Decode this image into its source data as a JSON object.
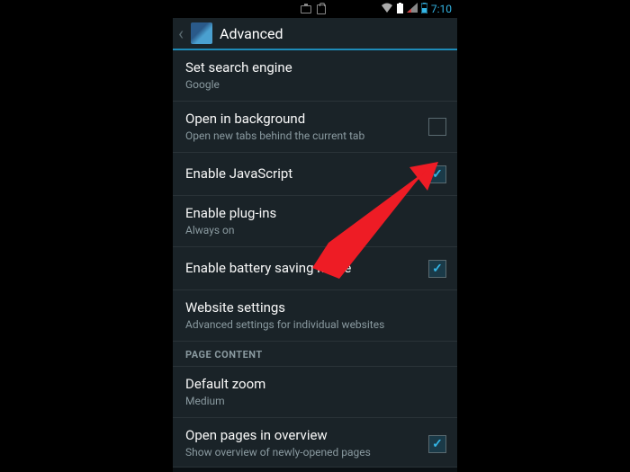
{
  "statusbar": {
    "time": "7:10"
  },
  "titlebar": {
    "title": "Advanced"
  },
  "items": {
    "search": {
      "title": "Set search engine",
      "sub": "Google"
    },
    "openbg": {
      "title": "Open in background",
      "sub": "Open new tabs behind the current tab"
    },
    "js": {
      "title": "Enable JavaScript"
    },
    "plugins": {
      "title": "Enable plug-ins",
      "sub": "Always on"
    },
    "battery": {
      "title": "Enable battery saving mode"
    },
    "website": {
      "title": "Website settings",
      "sub": "Advanced settings for individual websites"
    },
    "zoom": {
      "title": "Default zoom",
      "sub": "Medium"
    },
    "overview": {
      "title": "Open pages in overview",
      "sub": "Show overview of newly-opened pages"
    }
  },
  "sections": {
    "pagecontent": "PAGE CONTENT"
  }
}
